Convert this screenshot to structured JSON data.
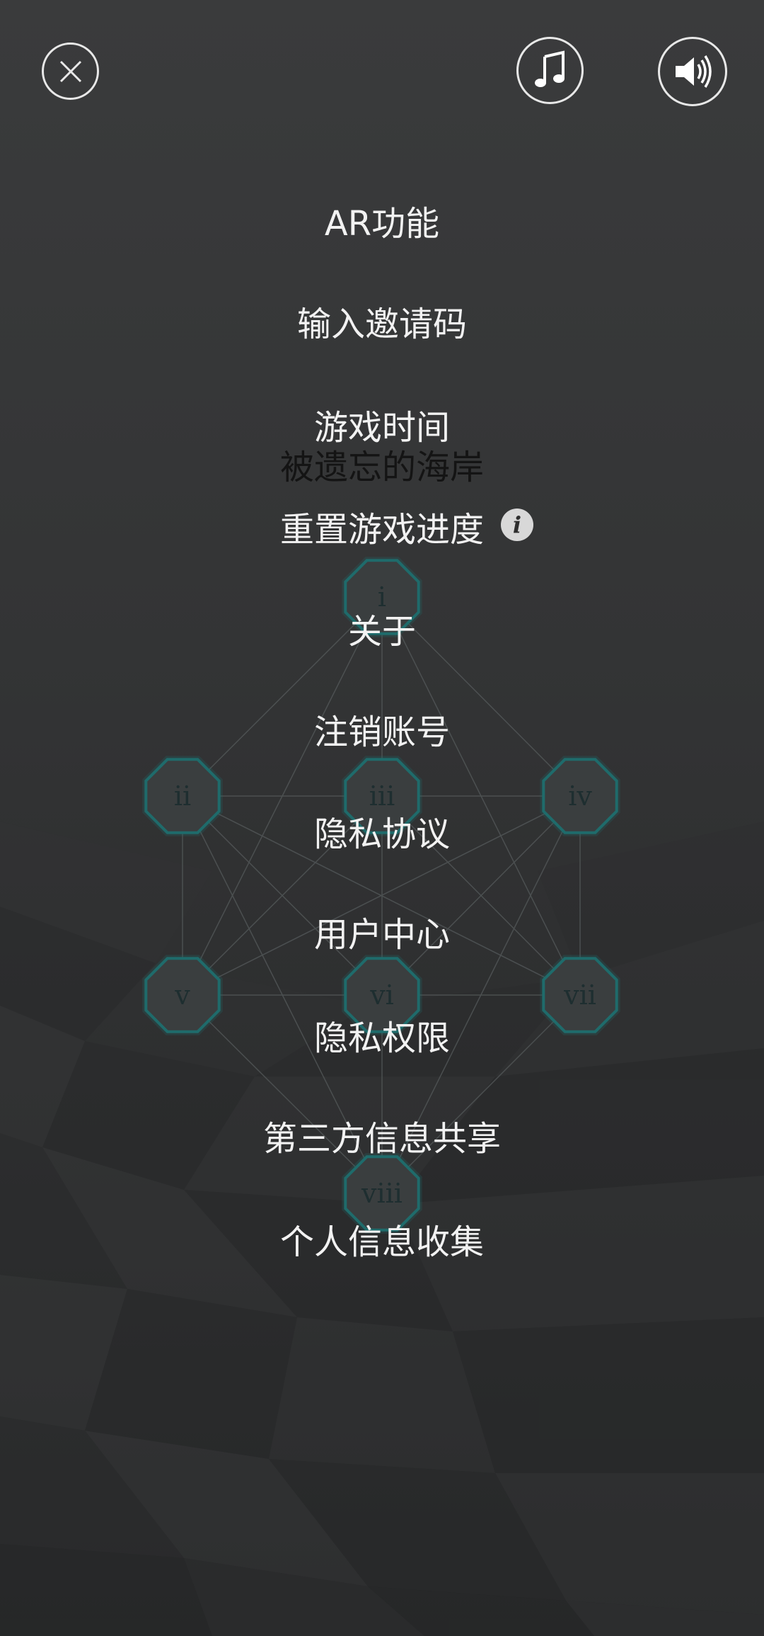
{
  "top_bar": {
    "close_icon": "close-icon",
    "music_icon": "music-note-icon",
    "sound_icon": "speaker-volume-icon",
    "icon_color": "#e8e8e8"
  },
  "menu": {
    "ar": "AR功能",
    "invite_code": "输入邀请码",
    "play_time_label": "游戏时间",
    "chapter_name": "被遗忘的海岸",
    "reset_progress": "重置游戏进度",
    "info_icon_glyph": "i",
    "about": "关于",
    "cancel_account": "注销账号",
    "privacy_agreement": "隐私协议",
    "user_center": "用户中心",
    "privacy_permissions": "隐私权限",
    "third_party_sharing": "第三方信息共享",
    "personal_info_collection": "个人信息收集"
  },
  "constellation": {
    "nodes": [
      {
        "id": "i",
        "label": "i"
      },
      {
        "id": "ii",
        "label": "ii"
      },
      {
        "id": "iii",
        "label": "iii"
      },
      {
        "id": "iv",
        "label": "iv"
      },
      {
        "id": "v",
        "label": "v"
      },
      {
        "id": "vi",
        "label": "vi"
      },
      {
        "id": "vii",
        "label": "vii"
      },
      {
        "id": "viii",
        "label": "viii"
      }
    ],
    "node_fill": "#3a3e3f",
    "node_stroke": "#1f6b6b",
    "edge_color": "#555a5b"
  }
}
